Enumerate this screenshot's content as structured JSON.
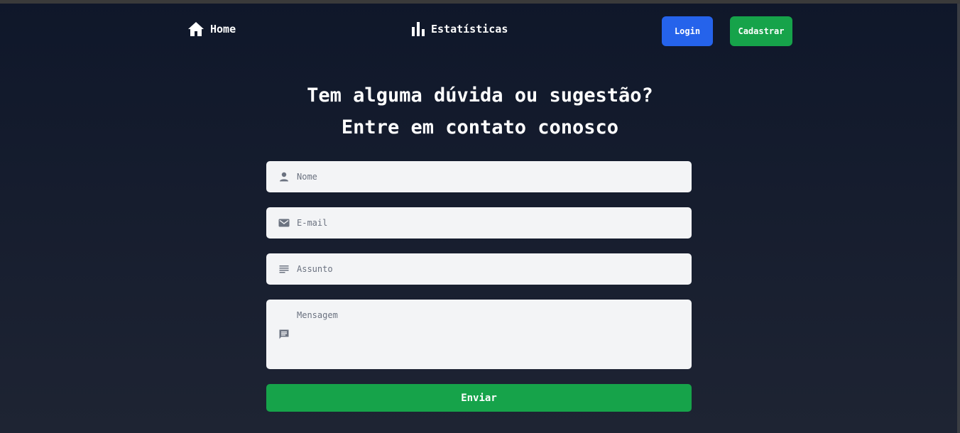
{
  "nav": {
    "home_label": "Home",
    "home_icon": "home-icon",
    "stats_label": "Estatísticas",
    "stats_icon": "bar-chart-icon",
    "login_label": "Login",
    "signup_label": "Cadastrar"
  },
  "contact": {
    "title_line1": "Tem alguma dúvida ou sugestão?",
    "title_line2": "Entre em contato conosco",
    "name": {
      "placeholder": "Nome",
      "value": "",
      "icon": "user-icon"
    },
    "email": {
      "placeholder": "E-mail",
      "value": "",
      "icon": "mail-icon"
    },
    "subject": {
      "placeholder": "Assunto",
      "value": "",
      "icon": "subject-lines-icon"
    },
    "message": {
      "placeholder": "Mensagem",
      "value": "",
      "icon": "message-icon"
    },
    "submit_label": "Enviar"
  },
  "colors": {
    "background_top": "#0f172a",
    "background_bottom": "#1e2433",
    "login_button": "#2563eb",
    "primary_green": "#16a34a",
    "input_background": "#f3f4f6",
    "icon_gray": "#6b7280"
  }
}
